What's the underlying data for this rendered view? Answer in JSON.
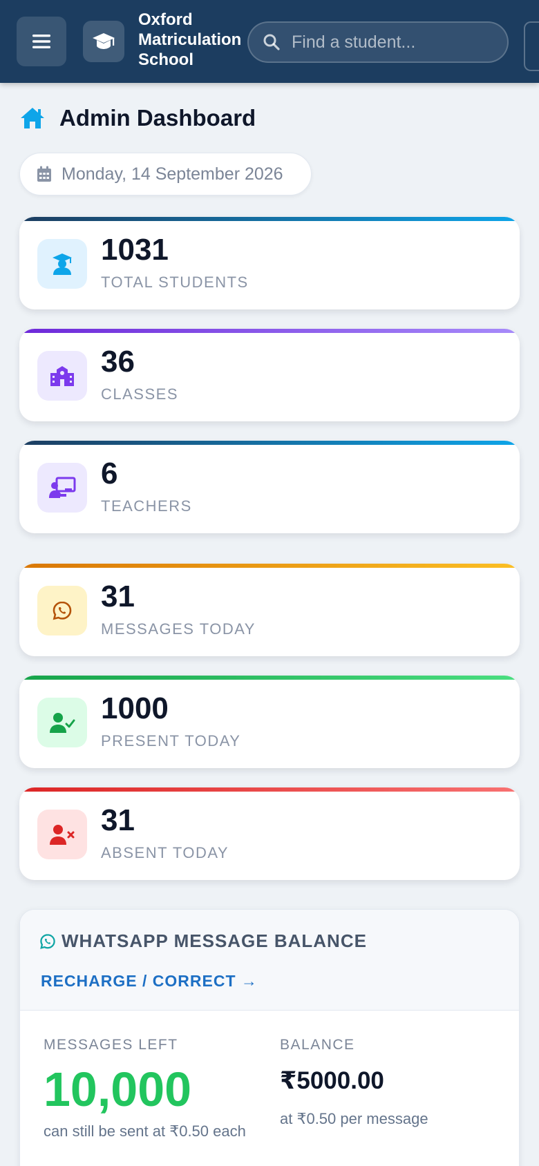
{
  "header": {
    "school_name": "Oxford Matriculation School",
    "search_placeholder": "Find a student..."
  },
  "page": {
    "title": "Admin Dashboard",
    "date": "Monday, 14 September 2026"
  },
  "stats": [
    {
      "value": "1031",
      "label": "TOTAL STUDENTS",
      "icon": "graduate-icon",
      "icon_color": "#0ea5e9",
      "icon_bg": "#e0f2fe",
      "bar": [
        "#1c3d60",
        "#0ea5e9"
      ]
    },
    {
      "value": "36",
      "label": "CLASSES",
      "icon": "school-icon",
      "icon_color": "#7c3aed",
      "icon_bg": "#ede9fe",
      "bar": [
        "#6d28d9",
        "#a78bfa"
      ]
    },
    {
      "value": "6",
      "label": "TEACHERS",
      "icon": "teacher-board-icon",
      "icon_color": "#7c3aed",
      "icon_bg": "#ede9fe",
      "bar": [
        "#1c3d60",
        "#0ea5e9"
      ]
    },
    {
      "value": "31",
      "label": "MESSAGES TODAY",
      "icon": "whatsapp-icon",
      "icon_color": "#b45309",
      "icon_bg": "#fef3c7",
      "bar": [
        "#d97706",
        "#fbbf24"
      ]
    },
    {
      "value": "1000",
      "label": "PRESENT TODAY",
      "icon": "user-check-icon",
      "icon_color": "#16a34a",
      "icon_bg": "#dcfce7",
      "bar": [
        "#16a34a",
        "#4ade80"
      ]
    },
    {
      "value": "31",
      "label": "ABSENT TODAY",
      "icon": "user-x-icon",
      "icon_color": "#dc2626",
      "icon_bg": "#fee2e2",
      "bar": [
        "#dc2626",
        "#f87171"
      ]
    }
  ],
  "whatsapp": {
    "title": "WHATSAPP MESSAGE BALANCE",
    "recharge_link": "RECHARGE / CORRECT →",
    "messages_left_label": "MESSAGES LEFT",
    "messages_left_value": "10,000",
    "messages_left_sub": "can still be sent at ₹0.50 each",
    "balance_label": "BALANCE",
    "balance_value": "₹5000.00",
    "balance_sub": "at ₹0.50 per message"
  },
  "colors": {
    "header_bg": "#1c3d60",
    "accent_blue": "#1d6fc4",
    "success_green": "#22c55e"
  }
}
